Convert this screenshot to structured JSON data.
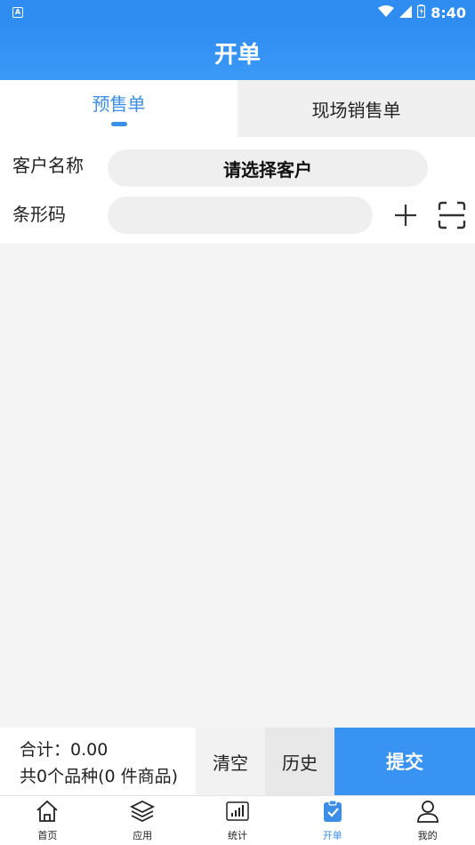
{
  "status_bar": {
    "badge": "A",
    "time": "8:40"
  },
  "header": {
    "title": "开单"
  },
  "tabs": [
    {
      "label": "预售单",
      "active": true
    },
    {
      "label": "现场销售单",
      "active": false
    }
  ],
  "form": {
    "customer_label": "客户名称",
    "customer_value": "请选择客户",
    "barcode_label": "条形码",
    "barcode_value": ""
  },
  "footer": {
    "total_line": "合计：0.00",
    "count_line": "共0个品种(0 件商品)",
    "clear_label": "清空",
    "history_label": "历史",
    "submit_label": "提交"
  },
  "bottom_nav": [
    {
      "label": "首页",
      "icon": "home-icon",
      "active": false
    },
    {
      "label": "应用",
      "icon": "layers-icon",
      "active": false
    },
    {
      "label": "统计",
      "icon": "stats-icon",
      "active": false
    },
    {
      "label": "开单",
      "icon": "clipboard-check-icon",
      "active": true
    },
    {
      "label": "我的",
      "icon": "user-icon",
      "active": false
    }
  ],
  "colors": {
    "primary": "#2f8df2",
    "tab_active": "#3a8ee6",
    "submit": "#3893f2"
  }
}
